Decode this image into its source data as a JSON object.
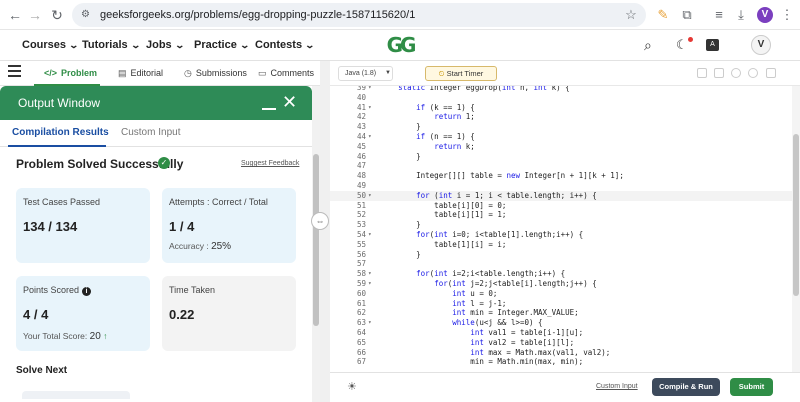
{
  "browser": {
    "url": "geeksforgeeks.org/problems/egg-dropping-puzzle-1587115620/1",
    "profile_initial": "V"
  },
  "header": {
    "menus": [
      "Courses",
      "Tutorials",
      "Jobs",
      "Practice",
      "Contests"
    ],
    "logo": "GG",
    "avatar_initial": "V"
  },
  "problem_tabs": [
    "Problem",
    "Editorial",
    "Submissions",
    "Comments"
  ],
  "output_window": {
    "title": "Output Window",
    "tabs": [
      "Compilation Results",
      "Custom Input"
    ],
    "status": "Problem Solved Successfully",
    "suggest_feedback": "Suggest Feedback",
    "cards": {
      "test_cases_label": "Test Cases Passed",
      "test_cases_value": "134 / 134",
      "attempts_label": "Attempts : Correct / Total",
      "attempts_value": "1 / 4",
      "accuracy_label": "Accuracy :",
      "accuracy_value": "25%",
      "points_label": "Points Scored",
      "points_value": "4 / 4",
      "total_score_label": "Your Total Score:",
      "total_score_value": "20",
      "time_label": "Time Taken",
      "time_value": "0.22"
    },
    "solve_next": "Solve Next"
  },
  "editor": {
    "language": "Java (1.8)",
    "timer_label": "Start Timer",
    "custom_input": "Custom Input",
    "compile_run": "Compile & Run",
    "submit": "Submit",
    "lines": [
      {
        "n": "39",
        "fold": "▾",
        "code": "    static Integer eggDrop(int n, int k) {"
      },
      {
        "n": "40",
        "fold": "",
        "code": ""
      },
      {
        "n": "41",
        "fold": "▾",
        "code": "        if (k == 1) {"
      },
      {
        "n": "42",
        "fold": "",
        "code": "            return 1;"
      },
      {
        "n": "43",
        "fold": "",
        "code": "        }"
      },
      {
        "n": "44",
        "fold": "▾",
        "code": "        if (n == 1) {"
      },
      {
        "n": "45",
        "fold": "",
        "code": "            return k;"
      },
      {
        "n": "46",
        "fold": "",
        "code": "        }"
      },
      {
        "n": "47",
        "fold": "",
        "code": ""
      },
      {
        "n": "48",
        "fold": "",
        "code": "        Integer[][] table = new Integer[n + 1][k + 1];"
      },
      {
        "n": "49",
        "fold": "",
        "code": ""
      },
      {
        "n": "50",
        "fold": "▾",
        "code": "        for (int i = 1; i < table.length; i++) {"
      },
      {
        "n": "51",
        "fold": "",
        "code": "            table[i][0] = 0;"
      },
      {
        "n": "52",
        "fold": "",
        "code": "            table[i][1] = 1;"
      },
      {
        "n": "53",
        "fold": "",
        "code": "        }"
      },
      {
        "n": "54",
        "fold": "▾",
        "code": "        for(int i=0; i<table[1].length;i++) {"
      },
      {
        "n": "55",
        "fold": "",
        "code": "            table[1][i] = i;"
      },
      {
        "n": "56",
        "fold": "",
        "code": "        }"
      },
      {
        "n": "57",
        "fold": "",
        "code": ""
      },
      {
        "n": "58",
        "fold": "▾",
        "code": "        for(int i=2;i<table.length;i++) {"
      },
      {
        "n": "59",
        "fold": "▾",
        "code": "            for(int j=2;j<table[i].length;j++) {"
      },
      {
        "n": "60",
        "fold": "",
        "code": "                int u = 0;"
      },
      {
        "n": "61",
        "fold": "",
        "code": "                int l = j-1;"
      },
      {
        "n": "62",
        "fold": "",
        "code": "                int min = Integer.MAX_VALUE;"
      },
      {
        "n": "63",
        "fold": "▾",
        "code": "                while(u<j && l>=0) {"
      },
      {
        "n": "64",
        "fold": "",
        "code": "                    int val1 = table[i-1][u];"
      },
      {
        "n": "65",
        "fold": "",
        "code": "                    int val2 = table[i][l];"
      },
      {
        "n": "66",
        "fold": "",
        "code": "                    int max = Math.max(val1, val2);"
      },
      {
        "n": "67",
        "fold": "",
        "code": "                    min = Math.min(max, min);"
      }
    ]
  },
  "colors": {
    "brand_green": "#2f8d46",
    "output_header": "#2e8b57",
    "card_blue": "#e8f4fb",
    "card_gray": "#f3f3f3",
    "link_blue": "#1a4ea2"
  }
}
